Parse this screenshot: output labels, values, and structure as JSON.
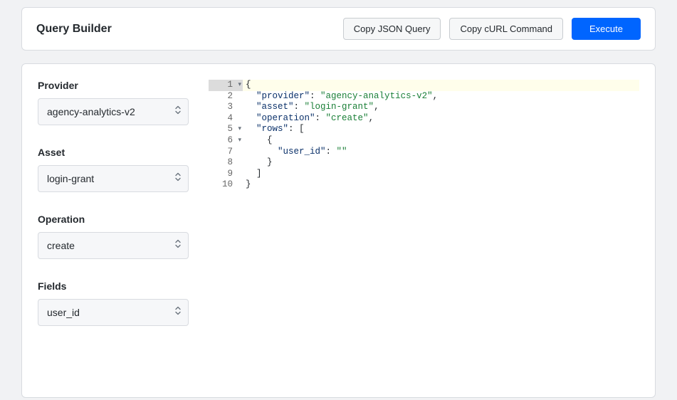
{
  "header": {
    "title": "Query Builder",
    "buttons": {
      "copy_json": "Copy JSON Query",
      "copy_curl": "Copy cURL Command",
      "execute": "Execute"
    }
  },
  "form": {
    "provider": {
      "label": "Provider",
      "value": "agency-analytics-v2"
    },
    "asset": {
      "label": "Asset",
      "value": "login-grant"
    },
    "operation": {
      "label": "Operation",
      "value": "create"
    },
    "fields": {
      "label": "Fields",
      "value": "user_id"
    }
  },
  "editor": {
    "active_line": 1,
    "fold_lines": [
      1,
      5,
      6
    ],
    "line_count": 10,
    "json": {
      "provider": "agency-analytics-v2",
      "asset": "login-grant",
      "operation": "create",
      "rows": [
        {
          "user_id": ""
        }
      ]
    },
    "lines": [
      {
        "n": 1,
        "html": "<span class='tok-punc'>{</span>"
      },
      {
        "n": 2,
        "html": "  <span class='tok-key'>\"provider\"</span><span class='tok-punc'>: </span><span class='tok-str'>\"agency-analytics-v2\"</span><span class='tok-punc'>,</span>"
      },
      {
        "n": 3,
        "html": "  <span class='tok-key'>\"asset\"</span><span class='tok-punc'>: </span><span class='tok-str'>\"login-grant\"</span><span class='tok-punc'>,</span>"
      },
      {
        "n": 4,
        "html": "  <span class='tok-key'>\"operation\"</span><span class='tok-punc'>: </span><span class='tok-str'>\"create\"</span><span class='tok-punc'>,</span>"
      },
      {
        "n": 5,
        "html": "  <span class='tok-key'>\"rows\"</span><span class='tok-punc'>: [</span>"
      },
      {
        "n": 6,
        "html": "    <span class='tok-punc'>{</span>"
      },
      {
        "n": 7,
        "html": "      <span class='tok-key'>\"user_id\"</span><span class='tok-punc'>: </span><span class='tok-str'>\"\"</span>"
      },
      {
        "n": 8,
        "html": "    <span class='tok-punc'>}</span>"
      },
      {
        "n": 9,
        "html": "  <span class='tok-punc'>]</span>"
      },
      {
        "n": 10,
        "html": "<span class='tok-punc'>}</span>"
      }
    ]
  }
}
